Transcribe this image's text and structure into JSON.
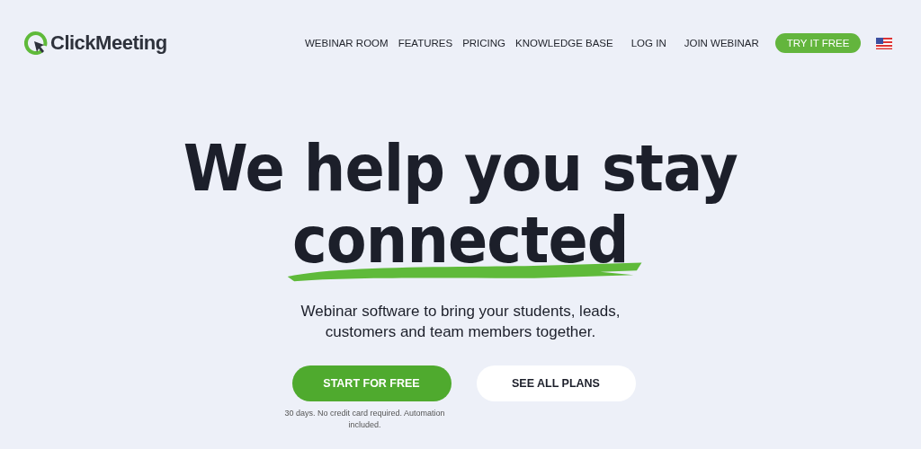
{
  "logo": {
    "text": "ClickMeeting"
  },
  "nav": [
    {
      "label": "WEBINAR ROOM",
      "kind": "link"
    },
    {
      "label": "FEATURES",
      "kind": "link"
    },
    {
      "label": "PRICING",
      "kind": "link"
    },
    {
      "label": "KNOWLEDGE BASE",
      "kind": "link"
    },
    {
      "label": "LOG IN",
      "kind": "link"
    },
    {
      "label": "JOIN WEBINAR",
      "kind": "link"
    },
    {
      "label": "TRY IT FREE",
      "kind": "cta"
    }
  ],
  "hero": {
    "headline": "We help you stay",
    "highlight": "connected",
    "subtitle_lines": [
      "Webinar software to bring your students, leads,",
      "customers and team members together."
    ],
    "buttons": [
      {
        "label": "START FOR FREE",
        "kind": "primary"
      },
      {
        "label": "SEE ALL PLANS",
        "kind": "secondary"
      }
    ],
    "note": "30 days. No credit card required. Automation included."
  }
}
